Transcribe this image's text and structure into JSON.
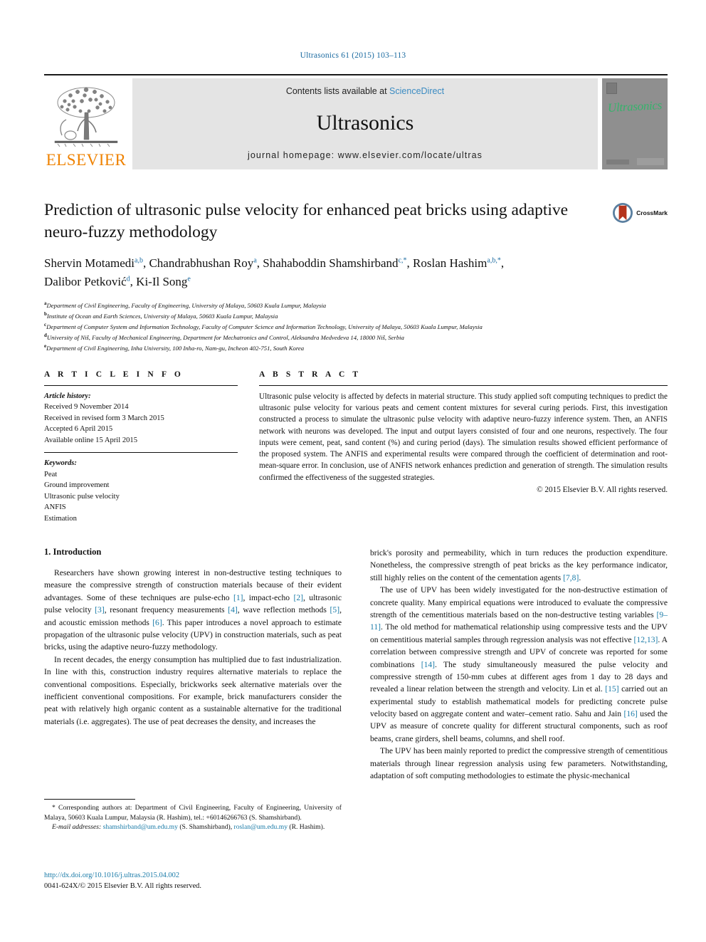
{
  "running_head": "Ultrasonics 61 (2015) 103–113",
  "masthead": {
    "publisher_name": "ELSEVIER",
    "contents_prefix": "Contents lists available at ",
    "contents_link": "ScienceDirect",
    "journal_name": "Ultrasonics",
    "homepage": "journal homepage: www.elsevier.com/locate/ultras",
    "cover_title": "Ultrasonics"
  },
  "article": {
    "title": "Prediction of ultrasonic pulse velocity for enhanced peat bricks using adaptive neuro-fuzzy methodology",
    "crossmark_label": "CrossMark",
    "authors_line_1": "Shervin Motamedi a,b, Chandrabhushan Roy a, Shahaboddin Shamshirband c,*, Roslan Hashim a,b,*,",
    "authors_line_2": "Dalibor Petković d, Ki-Il Song e",
    "authors": [
      {
        "name": "Shervin Motamedi",
        "sup": "a,b",
        "sep": ", "
      },
      {
        "name": "Chandrabhushan Roy",
        "sup": "a",
        "sep": ", "
      },
      {
        "name": "Shahaboddin Shamshirband",
        "sup": "c,*",
        "sep": ", "
      },
      {
        "name": "Roslan Hashim",
        "sup": "a,b,*",
        "sep": ", "
      },
      {
        "name": "Dalibor Petković",
        "sup": "d",
        "sep": ", "
      },
      {
        "name": "Ki-Il Song",
        "sup": "e",
        "sep": ""
      }
    ],
    "affiliations": [
      {
        "marker": "a",
        "text": "Department of Civil Engineering, Faculty of Engineering, University of Malaya, 50603 Kuala Lumpur, Malaysia"
      },
      {
        "marker": "b",
        "text": "Institute of Ocean and Earth Sciences, University of Malaya, 50603 Kuala Lumpur, Malaysia"
      },
      {
        "marker": "c",
        "text": "Department of Computer System and Information Technology, Faculty of Computer Science and Information Technology, University of Malaya, 50603 Kuala Lumpur, Malaysia"
      },
      {
        "marker": "d",
        "text": "University of Niš, Faculty of Mechanical Engineering, Department for Mechatronics and Control, Aleksandra Medvedeva 14, 18000 Niš, Serbia"
      },
      {
        "marker": "e",
        "text": "Department of Civil Engineering, Inha University, 100 Inha-ro, Nam-gu, Incheon 402-751, South Korea"
      }
    ]
  },
  "article_info": {
    "heading": "A R T I C L E    I N F O",
    "history_label": "Article history:",
    "history": [
      "Received 9 November 2014",
      "Received in revised form 3 March 2015",
      "Accepted 6 April 2015",
      "Available online 15 April 2015"
    ],
    "keywords_label": "Keywords:",
    "keywords": [
      "Peat",
      "Ground improvement",
      "Ultrasonic pulse velocity",
      "ANFIS",
      "Estimation"
    ]
  },
  "abstract": {
    "heading": "A B S T R A C T",
    "text": "Ultrasonic pulse velocity is affected by defects in material structure. This study applied soft computing techniques to predict the ultrasonic pulse velocity for various peats and cement content mixtures for several curing periods. First, this investigation constructed a process to simulate the ultrasonic pulse velocity with adaptive neuro-fuzzy inference system. Then, an ANFIS network with neurons was developed. The input and output layers consisted of four and one neurons, respectively. The four inputs were cement, peat, sand content (%) and curing period (days). The simulation results showed efficient performance of the proposed system. The ANFIS and experimental results were compared through the coefficient of determination and root-mean-square error. In conclusion, use of ANFIS network enhances prediction and generation of strength. The simulation results confirmed the effectiveness of the suggested strategies.",
    "copyright": "© 2015 Elsevier B.V. All rights reserved."
  },
  "body": {
    "section_heading": "1. Introduction",
    "left_paragraphs": [
      "Researchers have shown growing interest in non-destructive testing techniques to measure the compressive strength of construction materials because of their evident advantages. Some of these techniques are pulse-echo [1], impact-echo [2], ultrasonic pulse velocity [3], resonant frequency measurements [4], wave reflection methods [5], and acoustic emission methods [6]. This paper introduces a novel approach to estimate propagation of the ultrasonic pulse velocity (UPV) in construction materials, such as peat bricks, using the adaptive neuro-fuzzy methodology.",
      "In recent decades, the energy consumption has multiplied due to fast industrialization. In line with this, construction industry requires alternative materials to replace the conventional compositions. Especially, brickworks seek alternative materials over the inefficient conventional compositions. For example, brick manufacturers consider the peat with relatively high organic content as a sustainable alternative for the traditional materials (i.e. aggregates). The use of peat decreases the density, and increases the"
    ],
    "right_paragraphs": [
      "brick's porosity and permeability, which in turn reduces the production expenditure. Nonetheless, the compressive strength of peat bricks as the key performance indicator, still highly relies on the content of the cementation agents [7,8].",
      "The use of UPV has been widely investigated for the non-destructive estimation of concrete quality. Many empirical equations were introduced to evaluate the compressive strength of the cementitious materials based on the non-destructive testing variables [9–11]. The old method for mathematical relationship using compressive tests and the UPV on cementitious material samples through regression analysis was not effective [12,13]. A correlation between compressive strength and UPV of concrete was reported for some combinations [14]. The study simultaneously measured the pulse velocity and compressive strength of 150-mm cubes at different ages from 1 day to 28 days and revealed a linear relation between the strength and velocity. Lin et al. [15] carried out an experimental study to establish mathematical models for predicting concrete pulse velocity based on aggregate content and water–cement ratio. Sahu and Jain [16] used the UPV as measure of concrete quality for different structural components, such as roof beams, crane girders, shell beams, columns, and shell roof.",
      "The UPV has been mainly reported to predict the compressive strength of cementitious materials through linear regression analysis using few parameters. Notwithstanding, adaptation of soft computing methodologies to estimate the physic-mechanical"
    ]
  },
  "footnotes": {
    "corresponding": "* Corresponding authors at: Department of Civil Engineering, Faculty of Engineering, University of Malaya, 50603 Kuala Lumpur, Malaysia (R. Hashim), tel.: +60146266763 (S. Shamshirband).",
    "email_label": "E-mail addresses:",
    "email_1": "shamshirband@um.edu.my",
    "email_1_owner": "(S. Shamshirband),",
    "email_2": "roslan@um.edu.my",
    "email_2_owner": "(R. Hashim)."
  },
  "doi": {
    "url": "http://dx.doi.org/10.1016/j.ultras.2015.04.002",
    "issn": "0041-624X/© 2015 Elsevier B.V. All rights reserved."
  },
  "colors": {
    "link": "#1a7ba8",
    "elsevier_orange": "#ef8200",
    "cover_green": "#35b36b",
    "band_gray": "#e4e4e4"
  }
}
